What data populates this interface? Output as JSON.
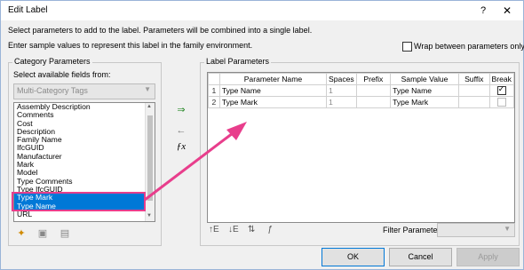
{
  "dialog": {
    "title": "Edit Label",
    "help_label": "?",
    "close_label": "✕"
  },
  "instructions": {
    "line1": "Select parameters to add to the label.  Parameters will be combined into a single label.",
    "line2": "Enter sample values to represent this label in the family environment."
  },
  "wrap_option": {
    "label": "Wrap between parameters only",
    "checked": false
  },
  "category_parameters": {
    "group_label": "Category Parameters",
    "select_label": "Select available fields from:",
    "dropdown_value": "Multi-Category Tags",
    "fields": [
      {
        "label": "Assembly Description",
        "selected": false
      },
      {
        "label": "Comments",
        "selected": false
      },
      {
        "label": "Cost",
        "selected": false
      },
      {
        "label": "Description",
        "selected": false
      },
      {
        "label": "Family Name",
        "selected": false
      },
      {
        "label": "IfcGUID",
        "selected": false
      },
      {
        "label": "Manufacturer",
        "selected": false
      },
      {
        "label": "Mark",
        "selected": false
      },
      {
        "label": "Model",
        "selected": false
      },
      {
        "label": "Type Comments",
        "selected": false
      },
      {
        "label": "Type IfcGUID",
        "selected": false
      },
      {
        "label": "Type Mark",
        "selected": true
      },
      {
        "label": "Type Name",
        "selected": true
      },
      {
        "label": "URL",
        "selected": false
      }
    ]
  },
  "label_parameters": {
    "group_label": "Label Parameters",
    "columns": [
      "Parameter Name",
      "Spaces",
      "Prefix",
      "Sample Value",
      "Suffix",
      "Break"
    ],
    "rows": [
      {
        "index": "1",
        "name": "Type Name",
        "spaces": "1",
        "prefix": "",
        "sample": "Type Name",
        "suffix": "",
        "break": true
      },
      {
        "index": "2",
        "name": "Type Mark",
        "spaces": "1",
        "prefix": "",
        "sample": "Type Mark",
        "suffix": "",
        "break": false
      }
    ]
  },
  "icons": {
    "add": "add-parameter-icon",
    "remove": "remove-parameter-icon",
    "formula": "fx-icon",
    "new_param": "new-parameter-icon",
    "edit_param": "edit-parameter-icon",
    "delete_param": "delete-parameter-icon",
    "move_up": "move-up-icon",
    "move_down": "move-down-icon",
    "sort": "sort-icon",
    "format": "format-icon",
    "fx_text": "ƒx"
  },
  "filter": {
    "label": "Filter Parameter:",
    "value": ""
  },
  "buttons": {
    "ok": "OK",
    "cancel": "Cancel",
    "apply": "Apply"
  },
  "colors": {
    "accent": "#0078d7",
    "annotation": "#e83e8c"
  }
}
